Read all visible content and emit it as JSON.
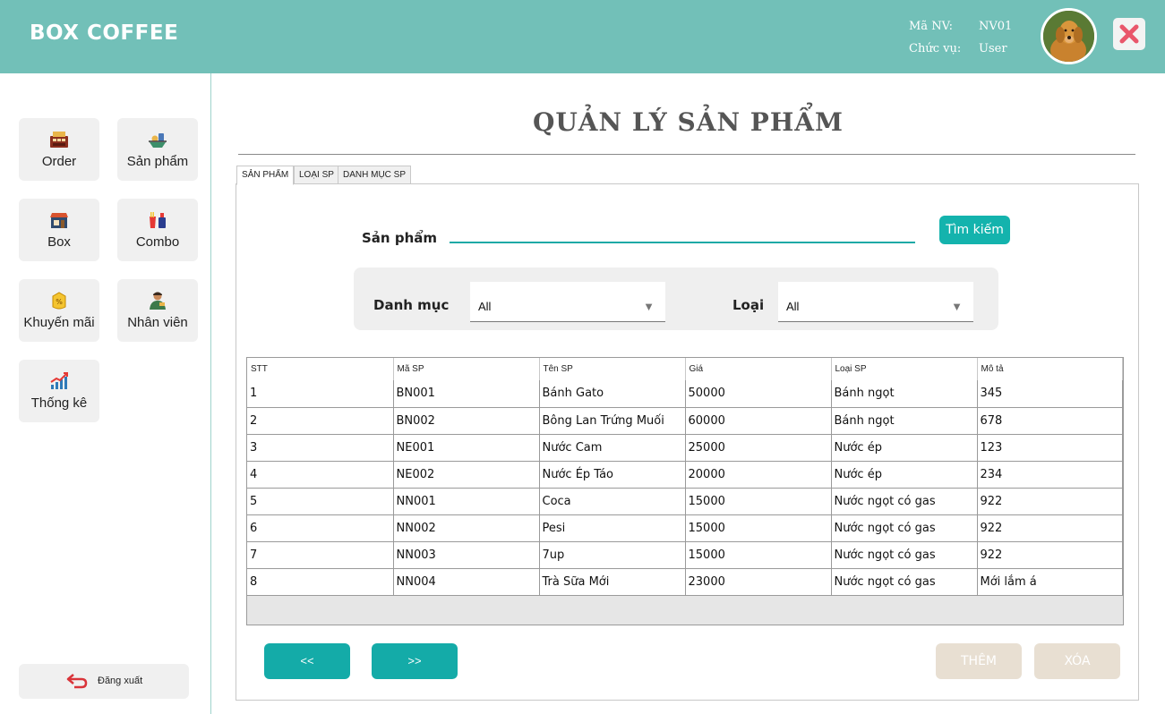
{
  "header": {
    "app_title": "BOX COFFEE",
    "employee_id_label": "Mã NV:",
    "employee_id": "NV01",
    "role_label": "Chức vụ:",
    "role": "User"
  },
  "sidebar": {
    "items": [
      {
        "label": "Order",
        "icon": "cash-register-icon"
      },
      {
        "label": "Sản phẩm",
        "icon": "food-tray-icon"
      },
      {
        "label": "Box",
        "icon": "shop-box-icon"
      },
      {
        "label": "Combo",
        "icon": "fastfood-combo-icon"
      },
      {
        "label": "Khuyến mãi",
        "icon": "discount-tag-icon"
      },
      {
        "label": "Nhân viên",
        "icon": "staff-icon"
      },
      {
        "label": "Thống kê",
        "icon": "statistics-chart-icon"
      }
    ],
    "logout_label": "Đăng xuất"
  },
  "page": {
    "title": "QUẢN LÝ SẢN PHẨM"
  },
  "tabs": [
    {
      "label": "SẢN PHẨM",
      "active": true
    },
    {
      "label": "LOẠI SP",
      "active": false
    },
    {
      "label": "DANH MỤC SP",
      "active": false
    }
  ],
  "search": {
    "label": "Sản phẩm",
    "value": "",
    "placeholder": "",
    "button_label": "Tìm kiếm"
  },
  "filters": {
    "category_label": "Danh mục",
    "category_value": "All",
    "type_label": "Loại",
    "type_value": "All"
  },
  "table": {
    "columns": [
      "STT",
      "Mã SP",
      "Tên SP",
      "Giá",
      "Loại SP",
      "Mô tả"
    ],
    "rows": [
      [
        "1",
        "BN001",
        "Bánh Gato",
        "50000",
        "Bánh ngọt",
        "345"
      ],
      [
        "2",
        "BN002",
        "Bông Lan Trứng Muối",
        "60000",
        "Bánh ngọt",
        "678"
      ],
      [
        "3",
        "NE001",
        "Nước Cam",
        "25000",
        "Nước ép",
        "123"
      ],
      [
        "4",
        "NE002",
        "Nước Ép Táo",
        "20000",
        "Nước ép",
        "234"
      ],
      [
        "5",
        "NN001",
        "Coca",
        "15000",
        "Nước ngọt có gas",
        "922"
      ],
      [
        "6",
        "NN002",
        "Pesi",
        "15000",
        "Nước ngọt có gas",
        "922"
      ],
      [
        "7",
        "NN003",
        "7up",
        "15000",
        "Nước ngọt có gas",
        "922"
      ],
      [
        "8",
        "NN004",
        "Trà Sữa Mới",
        "23000",
        "Nước ngọt có gas",
        "Mới lắm á"
      ]
    ]
  },
  "buttons": {
    "prev_label": "<<",
    "next_label": ">>",
    "add_label": "THÊM",
    "delete_label": "XÓA"
  },
  "colors": {
    "header_bg": "#72c0b8",
    "accent": "#14b3ad",
    "disabled_action": "#e8dfd2",
    "close_icon": "#e9566b"
  }
}
